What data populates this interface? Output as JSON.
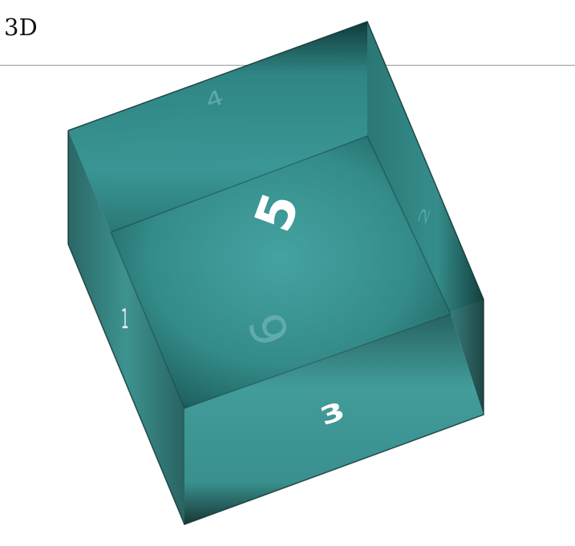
{
  "header": {
    "title": "3D"
  },
  "cube": {
    "face_color": "#3a9998",
    "edge_color": "#0d2f2e",
    "front_label": "5",
    "top_label": "4",
    "bottom_label": "3",
    "back_label": "6",
    "left_label": "1",
    "right_label": "2"
  }
}
